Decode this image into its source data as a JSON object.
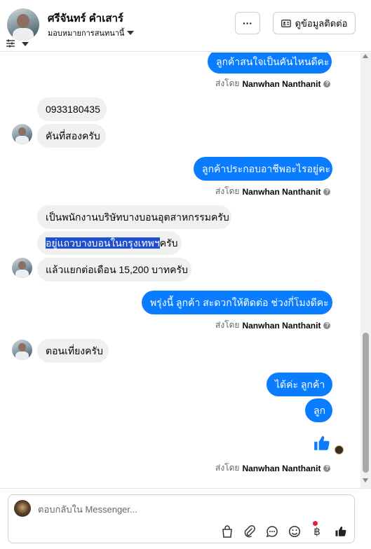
{
  "header": {
    "contact_name": "ศรีจันทร์ คำเสาร์",
    "assign_label": "มอบหมายการสนทนานี้",
    "more_label": "···",
    "contact_info_label": "ดูข้อมูลติดต่อ"
  },
  "messages": [
    {
      "side": "out",
      "text": "ลูกค้าสนใจเป็นคันไหนดีคะ"
    },
    {
      "side": "in",
      "text": "0933180435"
    },
    {
      "side": "in",
      "text": "คันที่สองครับ"
    },
    {
      "side": "out",
      "text": "ลูกค้าประกอบอาชีพอะไรอยู่คะ"
    },
    {
      "side": "in",
      "text": "เป็นพนักงานบริษัทบางบอนอุตสาหกรรมครับ"
    },
    {
      "side": "in",
      "text_highlight": "อยู่แถวบางบอนในกรุงเทพฯ",
      "text_rest": "ครับ"
    },
    {
      "side": "in",
      "text": "แล้วแยกต่อเดือน 15,200 บาทครับ"
    },
    {
      "side": "out",
      "text": "พรุ่งนี้ ลูกค้า  สะดวกให้ติดต่อ ช่วงกี่โมงดีคะ"
    },
    {
      "side": "in",
      "text": "ตอนเที่ยงครับ"
    },
    {
      "side": "out",
      "text": "ได้ค่ะ  ลูกค้า"
    },
    {
      "side": "out",
      "text": "ลูก"
    }
  ],
  "sent_by": {
    "prefix": "ส่งโดย",
    "name": "Nanwhan Nanthanit"
  },
  "composer": {
    "placeholder": "ตอบกลับใน Messenger..."
  },
  "icons": {
    "filter": "sliders-icon",
    "contact_card": "id-card-icon",
    "like": "thumbs-up-icon",
    "tools": [
      "shopping-bag-icon",
      "paperclip-icon",
      "chat-bubble-icon",
      "emoji-icon",
      "baht-icon",
      "thumbs-up-icon"
    ]
  },
  "colors": {
    "outgoing_bubble": "#0a7cff",
    "incoming_bubble": "#f0f0f0",
    "highlight": "#1f4fd1",
    "notification_dot": "#e41e3f"
  }
}
